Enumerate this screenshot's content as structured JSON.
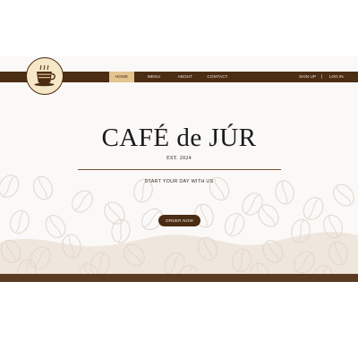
{
  "nav": {
    "items": [
      {
        "label": "HOME",
        "active": true
      },
      {
        "label": "MENU",
        "active": false
      },
      {
        "label": "ABOUT",
        "active": false
      },
      {
        "label": "CONTACT",
        "active": false
      }
    ],
    "auth": {
      "signup_label": "SIGN UP",
      "separator": "|",
      "login_label": "LOG IN"
    }
  },
  "logo": {
    "icon": "coffee-cup-icon"
  },
  "hero": {
    "title": "CAFÉ de JÚR",
    "established": "EST. 2024",
    "tagline": "START YOUR DAY WITH US",
    "cta_label": "ORDER NOW"
  },
  "background": {
    "pattern": "coffee-bean-icon"
  },
  "colors": {
    "primary_brown": "#4b2d14",
    "accent_gold": "#e2c48f",
    "cream": "#fbf9f7",
    "bean_outline": "#e3d8cf",
    "wave": "#efe6de"
  }
}
